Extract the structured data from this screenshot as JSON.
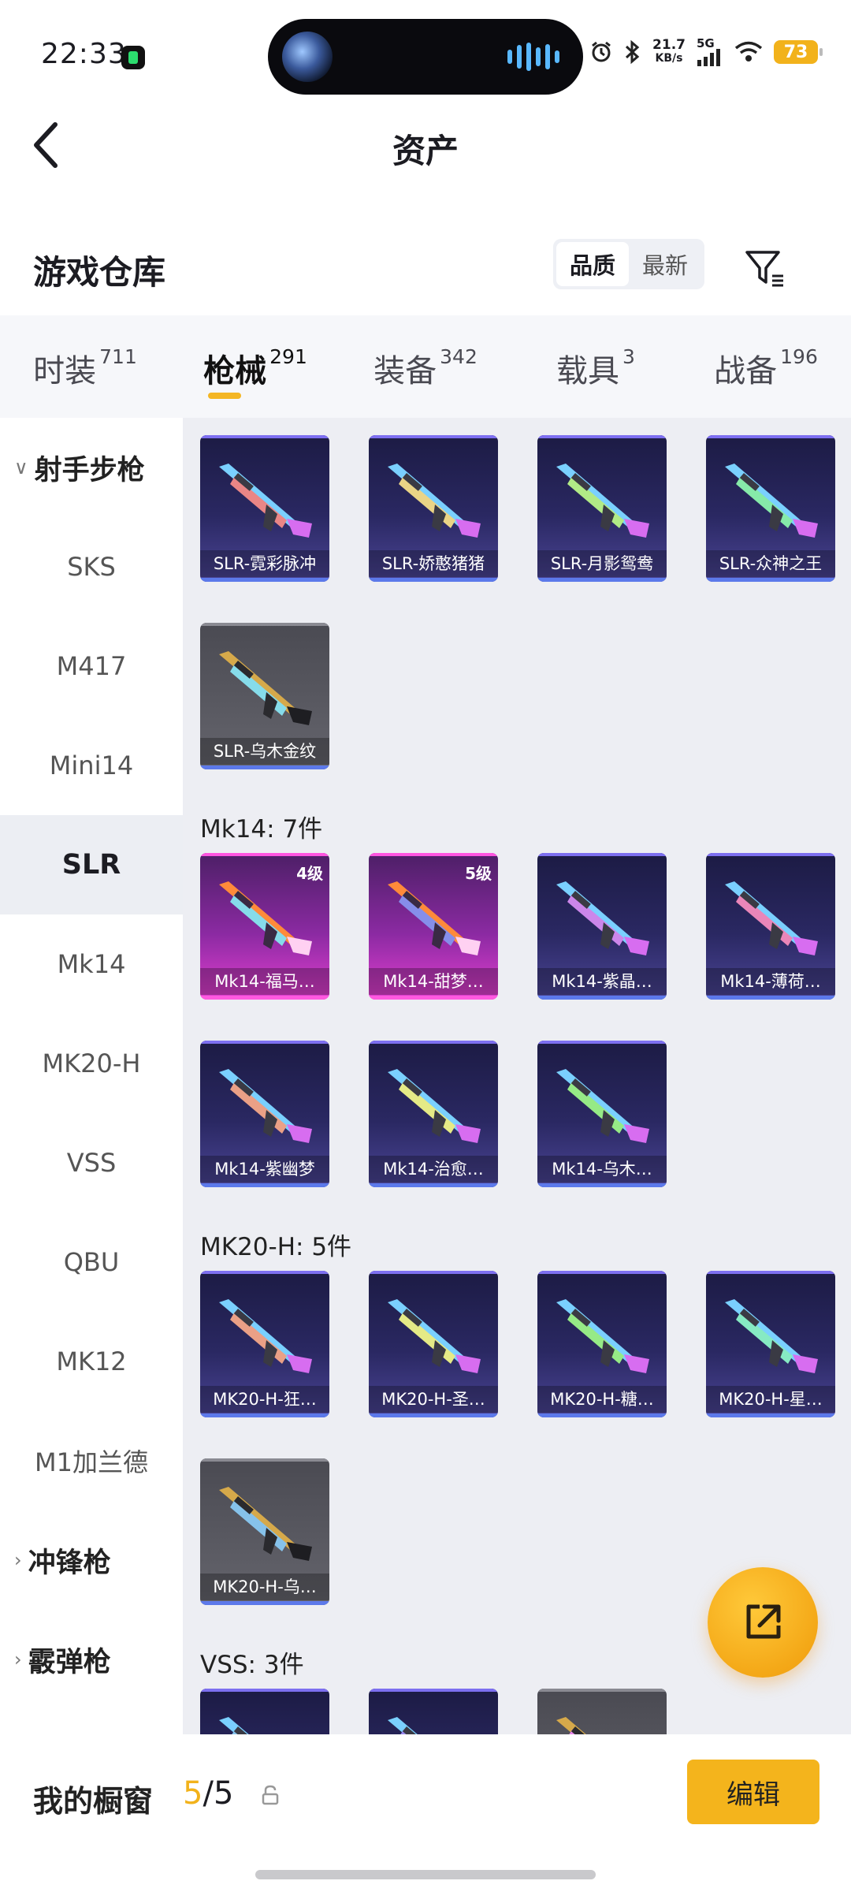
{
  "status_bar": {
    "time": "22:33",
    "net_speed_value": "21.7",
    "net_speed_unit": "KB/s",
    "signal_label": "5G",
    "battery": "73",
    "icons": [
      "alarm-icon",
      "bluetooth-icon",
      "signal-icon",
      "wifi-icon",
      "battery-icon"
    ]
  },
  "header": {
    "title": "资产",
    "back_icon": "chevron-left-icon"
  },
  "warehouse": {
    "title": "游戏仓库",
    "sort_options": [
      "品质",
      "最新"
    ],
    "sort_selected": "品质",
    "filter_icon": "filter-icon"
  },
  "tabs": [
    {
      "label": "时装",
      "count": "711",
      "active": false
    },
    {
      "label": "枪械",
      "count": "291",
      "active": true
    },
    {
      "label": "装备",
      "count": "342",
      "active": false
    },
    {
      "label": "载具",
      "count": "3",
      "active": false
    },
    {
      "label": "战备",
      "count": "196",
      "active": false
    }
  ],
  "sidebar": {
    "items": [
      {
        "label": "射手步枪",
        "type": "group-expanded"
      },
      {
        "label": "SKS",
        "type": "item"
      },
      {
        "label": "M417",
        "type": "item"
      },
      {
        "label": "Mini14",
        "type": "item"
      },
      {
        "label": "SLR",
        "type": "item-active"
      },
      {
        "label": "Mk14",
        "type": "item"
      },
      {
        "label": "MK20-H",
        "type": "item"
      },
      {
        "label": "VSS",
        "type": "item"
      },
      {
        "label": "QBU",
        "type": "item"
      },
      {
        "label": "MK12",
        "type": "item"
      },
      {
        "label": "M1加兰德",
        "type": "item"
      },
      {
        "label": "冲锋枪",
        "type": "group-collapsed"
      },
      {
        "label": "霰弹枪",
        "type": "group-collapsed"
      }
    ]
  },
  "sections": [
    {
      "title": "",
      "items": [
        {
          "name": "SLR-霓彩脉冲",
          "style": "purple",
          "level": ""
        },
        {
          "name": "SLR-娇憨猪猪",
          "style": "purple",
          "level": ""
        },
        {
          "name": "SLR-月影鸳鸯",
          "style": "purple",
          "level": ""
        },
        {
          "name": "SLR-众神之王",
          "style": "purple",
          "level": ""
        },
        {
          "name": "SLR-乌木金纹",
          "style": "grey",
          "level": ""
        }
      ]
    },
    {
      "title": "Mk14: 7件",
      "items": [
        {
          "name": "Mk14-福马…",
          "style": "pink",
          "level": "4级"
        },
        {
          "name": "Mk14-甜梦…",
          "style": "pink",
          "level": "5级"
        },
        {
          "name": "Mk14-紫晶…",
          "style": "purple",
          "level": ""
        },
        {
          "name": "Mk14-薄荷…",
          "style": "purple",
          "level": ""
        },
        {
          "name": "Mk14-紫幽梦",
          "style": "purple",
          "level": ""
        },
        {
          "name": "Mk14-治愈…",
          "style": "purple",
          "level": ""
        },
        {
          "name": "Mk14-乌木…",
          "style": "purple",
          "level": ""
        }
      ]
    },
    {
      "title": "MK20-H: 5件",
      "items": [
        {
          "name": "MK20-H-狂…",
          "style": "purple",
          "level": ""
        },
        {
          "name": "MK20-H-圣…",
          "style": "purple",
          "level": ""
        },
        {
          "name": "MK20-H-糖…",
          "style": "purple",
          "level": ""
        },
        {
          "name": "MK20-H-星…",
          "style": "purple",
          "level": ""
        },
        {
          "name": "MK20-H-乌…",
          "style": "grey",
          "level": ""
        }
      ]
    },
    {
      "title": "VSS: 3件",
      "items": [
        {
          "name": "",
          "style": "purple",
          "level": ""
        },
        {
          "name": "",
          "style": "purple",
          "level": ""
        },
        {
          "name": "",
          "style": "grey",
          "level": ""
        }
      ]
    }
  ],
  "fab": {
    "icon": "share-export-icon"
  },
  "showcase": {
    "label": "我的橱窗",
    "current": "5",
    "separator": "/",
    "total": "5",
    "lock_icon": "lock-open-icon",
    "edit_label": "编辑"
  },
  "colors": {
    "accent": "#f4b41c",
    "card_purple": "#2a2862",
    "card_pink": "#b12fc0",
    "card_grey": "#5a5a62",
    "content_bg": "#edeef3"
  }
}
